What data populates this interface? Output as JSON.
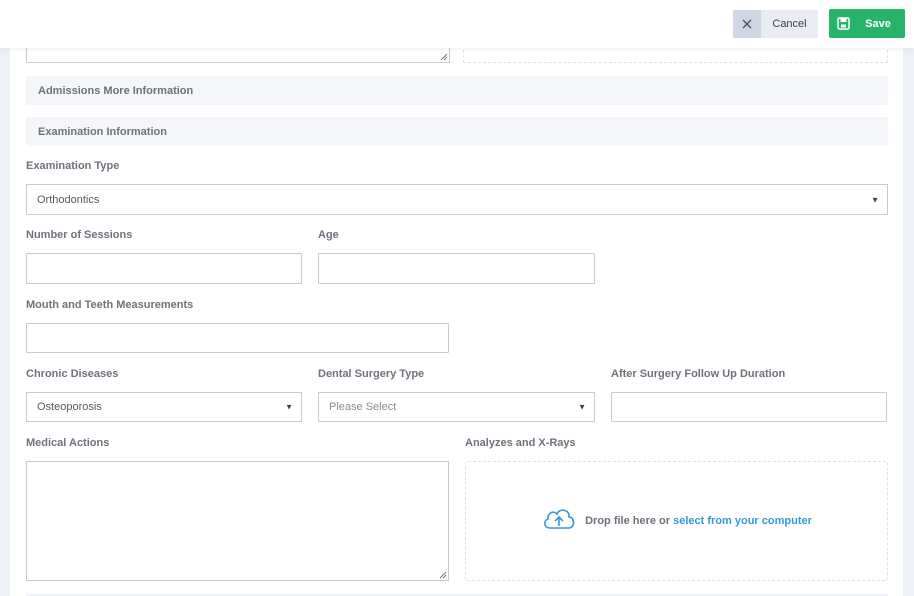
{
  "toolbar": {
    "cancel_label": "Cancel",
    "save_label": "Save",
    "save_color": "#27b36a"
  },
  "sections": {
    "admissions_more": "Admissions More Information",
    "examination_info": "Examination Information"
  },
  "fields": {
    "examination_type": {
      "label": "Examination Type",
      "value": "Orthodontics"
    },
    "number_of_sessions": {
      "label": "Number of Sessions",
      "value": ""
    },
    "age": {
      "label": "Age",
      "value": ""
    },
    "mouth_teeth": {
      "label": "Mouth and Teeth Measurements",
      "value": ""
    },
    "chronic_diseases": {
      "label": "Chronic Diseases",
      "value": "Osteoporosis"
    },
    "dental_surgery_type": {
      "label": "Dental Surgery Type",
      "placeholder": "Please Select"
    },
    "after_surgery": {
      "label": "After Surgery Follow Up Duration",
      "value": ""
    },
    "medical_actions": {
      "label": "Medical Actions",
      "value": ""
    },
    "analyzes_xrays": {
      "label": "Analyzes and X-Rays",
      "drop_text": "Drop file here or",
      "drop_link": "select from your computer",
      "link_color": "#3598dc"
    }
  },
  "icons": {
    "cancel": "close-icon",
    "save": "save-icon",
    "upload": "cloud-upload-icon",
    "caret": "caret-down-icon"
  }
}
